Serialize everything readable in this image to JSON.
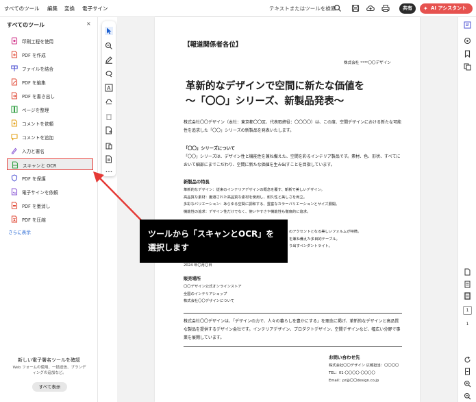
{
  "topbar": {
    "menus": [
      "すべてのツール",
      "編集",
      "変換",
      "電子サイン"
    ],
    "search_placeholder": "テキストまたはツールを検索",
    "share_label": "共有",
    "ai_label": "AI アシスタント"
  },
  "tools_panel": {
    "title": "すべてのツール",
    "close": "×",
    "items": [
      {
        "label": "印刷工程を使用",
        "icon": "print-production-icon",
        "color": "#d23b8e"
      },
      {
        "label": "PDF を作成",
        "icon": "create-pdf-icon",
        "color": "#e04c3a"
      },
      {
        "label": "ファイルを結合",
        "icon": "combine-files-icon",
        "color": "#5b5fd6"
      },
      {
        "label": "PDF を編集",
        "icon": "edit-pdf-icon",
        "color": "#e04c3a"
      },
      {
        "label": "PDF を書き出し",
        "icon": "export-pdf-icon",
        "color": "#e04c3a"
      },
      {
        "label": "ページを整理",
        "icon": "organize-pages-icon",
        "color": "#3aa24a"
      },
      {
        "label": "コメントを依頼",
        "icon": "request-comments-icon",
        "color": "#e3a21a"
      },
      {
        "label": "コメントを追加",
        "icon": "add-comment-icon",
        "color": "#e3a21a"
      },
      {
        "label": "入力と署名",
        "icon": "fill-sign-icon",
        "color": "#8c5bd6"
      },
      {
        "label": "スキャンと OCR",
        "icon": "scan-ocr-icon",
        "color": "#3aa24a"
      },
      {
        "label": "PDF を保護",
        "icon": "protect-pdf-icon",
        "color": "#5b5fd6"
      },
      {
        "label": "電子サインを依頼",
        "icon": "request-esign-icon",
        "color": "#8c5bd6"
      },
      {
        "label": "PDF を墨消し",
        "icon": "redact-pdf-icon",
        "color": "#e04c3a"
      },
      {
        "label": "PDF を圧縮",
        "icon": "compress-pdf-icon",
        "color": "#e04c3a"
      }
    ],
    "more_label": "さらに表示",
    "highlight_color": "#e53935",
    "promo": {
      "title": "新しい電子署名ツールを確認",
      "desc": "Web フォームの使用、一括送信、ブランディングの追加など。",
      "button": "すべて表示"
    }
  },
  "document": {
    "greeting": "【報道関係者各位】",
    "company": "株式会社 ****〇〇デザイン",
    "title_line1": "革新的なデザインで空間に新たな価値を",
    "title_line2": "〜「〇〇」シリーズ、新製品発表〜",
    "intro": "株式会社〇〇デザイン（本社：東京都〇〇区、代表取締役：〇〇〇〇）は、この度、空間デザインにおける新たな可能性を追求した「〇〇」シリーズの新製品を発表いたします。",
    "series_heading": "「〇〇」シリーズについて",
    "series_body": "「〇〇」シリーズは、デザイン性と機能性を兼ね備えた、空間を彩るインテリア製品です。素材、色、形状、すべてにおいて細部にまでこだわり、空間に新たな価値を生み出すことを目指しています。",
    "features_heading": "新製品の特長",
    "features": [
      "革新的なデザイン：従来のインテリアデザインの概念を覆す、斬新で美しいデザイン。",
      "高品質な素材：厳選された高品質な素材を使用し、耐久性と美しさを両立。",
      "多彩なバリエーション：あらゆる空間に調和する、豊富なカラーバリエーションとサイズ展開。",
      "機能性の追求：デザイン性だけでなく、使いやすさや機能性も徹底的に追求。"
    ],
    "partial_lines": [
      "のアクセントとなる美しいフォルムが特徴。",
      "を兼ね備えた多目的テーブル。",
      "り出すペンダントライト。"
    ],
    "date": "2024 年〇月〇日",
    "store_heading": "販売場所",
    "stores": [
      "〇〇デザイン公式オンラインストア",
      "全国のインテリアショップ",
      "株式会社〇〇デザインについて"
    ],
    "about": "株式会社〇〇デザインは、「デザインの力で、人々の暮らしを豊かにする」を理念に掲げ、革新的なデザインと高品質な製品を提供するデザイン会社です。インテリアデザイン、プロダクトデザイン、空間デザインなど、幅広い分野で事業を展開しています。",
    "contact_heading": "お問い合わせ先",
    "contact_lines": [
      "株式会社〇〇デザイン 広報担当：〇〇〇〇",
      "TEL：01-〇〇〇〇-〇〇〇〇",
      "Email：pr@〇〇design.co.jp"
    ]
  },
  "right_rail": {
    "page_current": "1",
    "page_total": "1"
  },
  "callout": {
    "line1": "ツールから「スキャンとOCR」を",
    "line2": "選択します",
    "arrow_color": "#e53935"
  }
}
